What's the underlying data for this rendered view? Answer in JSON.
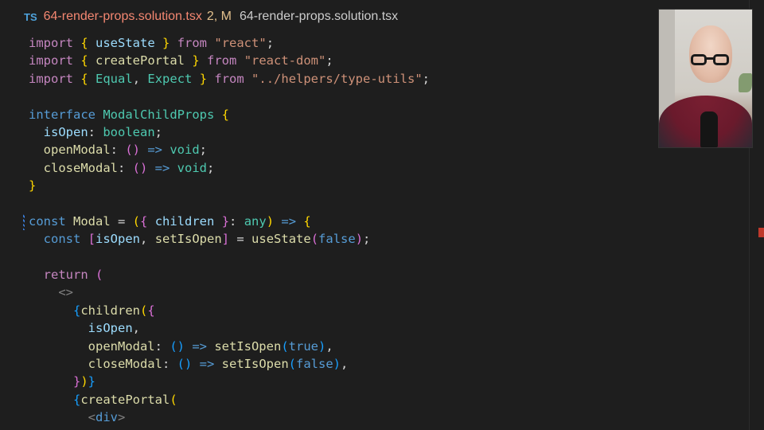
{
  "tab": {
    "language_badge": "TS",
    "file_name": "64-render-props.solution.tsx",
    "status": "2, M",
    "breadcrumb": "64-render-props.solution.tsx"
  },
  "colors": {
    "background": "#1e1e1e",
    "keyword": "#c586c0",
    "storage": "#569cd6",
    "type": "#4ec9b0",
    "function": "#dcdcaa",
    "variable": "#9cdcfe",
    "string": "#ce9178",
    "modified_tab": "#f48771"
  },
  "webcam": {
    "description_icon": "presenter-webcam"
  },
  "code": [
    [
      [
        "k",
        "import"
      ],
      [
        "",
        "&nbsp;"
      ],
      [
        "b1",
        "{"
      ],
      [
        "v",
        " useState "
      ],
      [
        "b1",
        "}"
      ],
      [
        "k",
        " from "
      ],
      [
        "s",
        "\"react\""
      ],
      [
        "",
        ";"
      ]
    ],
    [
      [
        "k",
        "import"
      ],
      [
        "",
        "&nbsp;"
      ],
      [
        "b1",
        "{"
      ],
      [
        "f",
        " createPortal "
      ],
      [
        "b1",
        "}"
      ],
      [
        "k",
        " from "
      ],
      [
        "s",
        "\"react-dom\""
      ],
      [
        "",
        ";"
      ]
    ],
    [
      [
        "k",
        "import"
      ],
      [
        "",
        "&nbsp;"
      ],
      [
        "b1",
        "{"
      ],
      [
        "t",
        " Equal"
      ],
      [
        "",
        ","
      ],
      [
        "t",
        " Expect "
      ],
      [
        "b1",
        "}"
      ],
      [
        "k",
        " from "
      ],
      [
        "s",
        "\"../helpers/type-utils\""
      ],
      [
        "",
        ";"
      ]
    ],
    [],
    [
      [
        "kb",
        "interface"
      ],
      [
        "t",
        " ModalChildProps "
      ],
      [
        "b1",
        "{"
      ]
    ],
    [
      [
        "v",
        "  isOpen"
      ],
      [
        "",
        ": "
      ],
      [
        "t",
        "boolean"
      ],
      [
        "",
        ";"
      ]
    ],
    [
      [
        "f",
        "  openModal"
      ],
      [
        "",
        ": "
      ],
      [
        "b2",
        "()"
      ],
      [
        "kb",
        " =>"
      ],
      [
        "t",
        " void"
      ],
      [
        "",
        ";"
      ]
    ],
    [
      [
        "f",
        "  closeModal"
      ],
      [
        "",
        ": "
      ],
      [
        "b2",
        "()"
      ],
      [
        "kb",
        " =>"
      ],
      [
        "t",
        " void"
      ],
      [
        "",
        ";"
      ]
    ],
    [
      [
        "b1",
        "}"
      ]
    ],
    [],
    [
      [
        "kb",
        "const"
      ],
      [
        "f",
        " Modal"
      ],
      [
        "",
        " = "
      ],
      [
        "b1",
        "("
      ],
      [
        "b2",
        "{"
      ],
      [
        "v",
        " children "
      ],
      [
        "b2",
        "}"
      ],
      [
        "",
        ": "
      ],
      [
        "t",
        "any"
      ],
      [
        "b1",
        ")"
      ],
      [
        "kb",
        " =>"
      ],
      [
        "",
        " "
      ],
      [
        "b1",
        "{"
      ]
    ],
    [
      [
        "kb",
        "  const"
      ],
      [
        "",
        " "
      ],
      [
        "b2",
        "["
      ],
      [
        "v",
        "isOpen"
      ],
      [
        "",
        ", "
      ],
      [
        "f",
        "setIsOpen"
      ],
      [
        "b2",
        "]"
      ],
      [
        "",
        " = "
      ],
      [
        "f",
        "useState"
      ],
      [
        "b2",
        "("
      ],
      [
        "kb",
        "false"
      ],
      [
        "b2",
        ")"
      ],
      [
        "",
        ";"
      ]
    ],
    [],
    [
      [
        "k",
        "  return"
      ],
      [
        "",
        " "
      ],
      [
        "b2",
        "("
      ]
    ],
    [
      [
        "p",
        "    <>"
      ]
    ],
    [
      [
        "b3",
        "      {"
      ],
      [
        "f",
        "children"
      ],
      [
        "b1",
        "("
      ],
      [
        "b2",
        "{"
      ]
    ],
    [
      [
        "v",
        "        isOpen"
      ],
      [
        "",
        ","
      ]
    ],
    [
      [
        "f",
        "        openModal"
      ],
      [
        "",
        ": "
      ],
      [
        "b3",
        "()"
      ],
      [
        "kb",
        " =>"
      ],
      [
        "f",
        " setIsOpen"
      ],
      [
        "b3",
        "("
      ],
      [
        "kb",
        "true"
      ],
      [
        "b3",
        ")"
      ],
      [
        "",
        ","
      ]
    ],
    [
      [
        "f",
        "        closeModal"
      ],
      [
        "",
        ": "
      ],
      [
        "b3",
        "()"
      ],
      [
        "kb",
        " =>"
      ],
      [
        "f",
        " setIsOpen"
      ],
      [
        "b3",
        "("
      ],
      [
        "kb",
        "false"
      ],
      [
        "b3",
        ")"
      ],
      [
        "",
        ","
      ]
    ],
    [
      [
        "b2",
        "      }"
      ],
      [
        "b1",
        ")"
      ],
      [
        "b3",
        "}"
      ]
    ],
    [
      [
        "b3",
        "      {"
      ],
      [
        "f",
        "createPortal"
      ],
      [
        "b1",
        "("
      ]
    ],
    [
      [
        "p",
        "        <"
      ],
      [
        "kb",
        "div"
      ],
      [
        "p",
        ">"
      ]
    ]
  ]
}
